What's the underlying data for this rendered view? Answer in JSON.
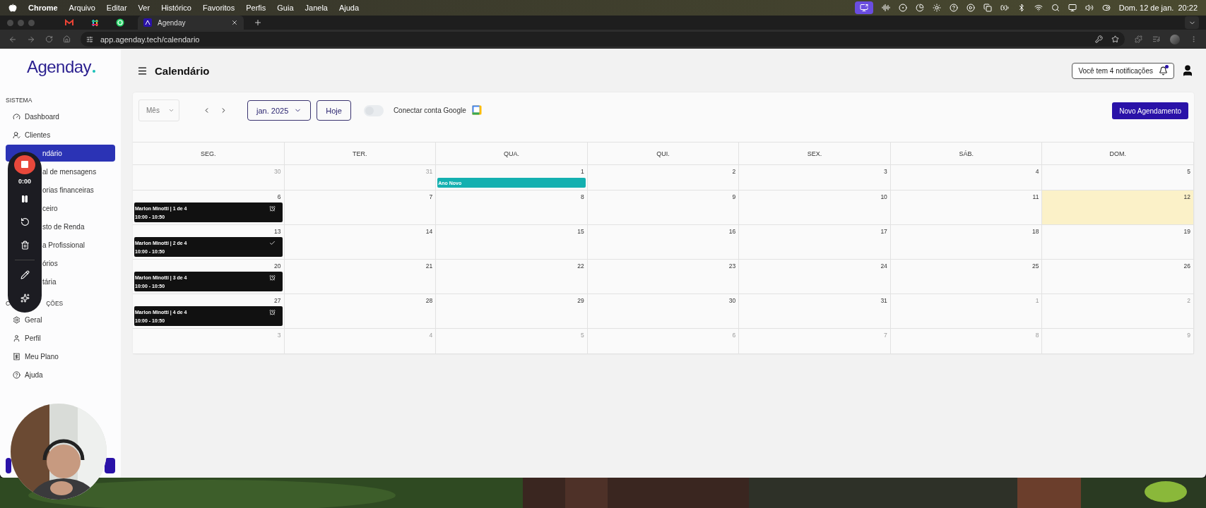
{
  "menu_bar": {
    "app": "Chrome",
    "menus": [
      "Arquivo",
      "Editar",
      "Ver",
      "Histórico",
      "Favoritos",
      "Perfis",
      "Guia",
      "Janela",
      "Ajuda"
    ],
    "clock": "Dom. 12 de jan.  20:22"
  },
  "browser": {
    "tabs": [
      {
        "kind": "mail",
        "selected": false
      },
      {
        "kind": "hash",
        "selected": false
      },
      {
        "kind": "chat",
        "selected": false
      },
      {
        "kind": "page",
        "title": "Agenday",
        "selected": true
      }
    ],
    "url": "app.agenday.tech/calendario"
  },
  "sidebar": {
    "logo": "Agenday",
    "sections": [
      {
        "title_parts": [
          "SISTEMA"
        ],
        "items": [
          {
            "label": "Dashboard",
            "kind": "full",
            "selected": false
          },
          {
            "label": "Clientes",
            "kind": "full",
            "selected": false
          },
          {
            "label": "ndário",
            "kind": "cut",
            "selected": true
          },
          {
            "label": "al de mensagens",
            "kind": "cut",
            "selected": false
          },
          {
            "label": "orias financeiras",
            "kind": "cut",
            "selected": false
          },
          {
            "label": "ceiro",
            "kind": "cut",
            "selected": false
          },
          {
            "label": "sto de Renda",
            "kind": "cut",
            "selected": false
          },
          {
            "label": "a Profissional",
            "kind": "cut",
            "selected": false
          },
          {
            "label": "órios",
            "kind": "cut",
            "selected": false
          },
          {
            "label": "tária",
            "kind": "cut",
            "selected": false
          }
        ]
      },
      {
        "title_parts": [
          "C",
          "ÇÕES"
        ],
        "items": [
          {
            "label": "Geral",
            "kind": "full",
            "selected": false
          },
          {
            "label": "Perfil",
            "kind": "full",
            "selected": false
          },
          {
            "label": "Meu Plano",
            "kind": "full",
            "selected": false
          },
          {
            "label": "Ajuda",
            "kind": "full",
            "selected": false
          }
        ]
      }
    ]
  },
  "recorder": {
    "time": "0:00"
  },
  "header": {
    "title": "Calendário",
    "notifications": "Você tem 4 notificações",
    "unread": true
  },
  "toolbar": {
    "view": "Mês",
    "month": "jan. 2025",
    "today": "Hoje",
    "google": {
      "label": "Conectar conta Google",
      "on": false
    },
    "new_button": "Novo Agendamento"
  },
  "calendar": {
    "weekdays": [
      "SEG.",
      "TER.",
      "QUA.",
      "QUI.",
      "SEX.",
      "SÁB.",
      "DOM."
    ],
    "weeks": [
      [
        {
          "day": "30",
          "muted": true,
          "today": false
        },
        {
          "day": "31",
          "muted": true,
          "today": false
        },
        {
          "day": "1",
          "muted": false,
          "today": false,
          "events": [
            {
              "kind": "holiday",
              "title": "Ano Novo",
              "color": "#14b0b0"
            }
          ]
        },
        {
          "day": "2",
          "muted": false,
          "today": false
        },
        {
          "day": "3",
          "muted": false,
          "today": false
        },
        {
          "day": "4",
          "muted": false,
          "today": false
        },
        {
          "day": "5",
          "muted": false,
          "today": false
        }
      ],
      [
        {
          "day": "6",
          "muted": false,
          "today": false,
          "events": [
            {
              "kind": "appointment",
              "title": "Marlon Minotti | 1 de 4",
              "time": "10:00 - 10:50",
              "done": false
            }
          ]
        },
        {
          "day": "7",
          "muted": false,
          "today": false
        },
        {
          "day": "8",
          "muted": false,
          "today": false
        },
        {
          "day": "9",
          "muted": false,
          "today": false
        },
        {
          "day": "10",
          "muted": false,
          "today": false
        },
        {
          "day": "11",
          "muted": false,
          "today": false
        },
        {
          "day": "12",
          "muted": false,
          "today": true
        }
      ],
      [
        {
          "day": "13",
          "muted": false,
          "today": false,
          "events": [
            {
              "kind": "appointment",
              "title": "Marlon Minotti | 2 de 4",
              "time": "10:00 - 10:50",
              "done": true
            }
          ]
        },
        {
          "day": "14",
          "muted": false,
          "today": false
        },
        {
          "day": "15",
          "muted": false,
          "today": false
        },
        {
          "day": "16",
          "muted": false,
          "today": false
        },
        {
          "day": "17",
          "muted": false,
          "today": false
        },
        {
          "day": "18",
          "muted": false,
          "today": false
        },
        {
          "day": "19",
          "muted": false,
          "today": false
        }
      ],
      [
        {
          "day": "20",
          "muted": false,
          "today": false,
          "events": [
            {
              "kind": "appointment",
              "title": "Marlon Minotti | 3 de 4",
              "time": "10:00 - 10:50",
              "done": false
            }
          ]
        },
        {
          "day": "21",
          "muted": false,
          "today": false
        },
        {
          "day": "22",
          "muted": false,
          "today": false
        },
        {
          "day": "23",
          "muted": false,
          "today": false
        },
        {
          "day": "24",
          "muted": false,
          "today": false
        },
        {
          "day": "25",
          "muted": false,
          "today": false
        },
        {
          "day": "26",
          "muted": false,
          "today": false
        }
      ],
      [
        {
          "day": "27",
          "muted": false,
          "today": false,
          "events": [
            {
              "kind": "appointment",
              "title": "Marlon Minotti | 4 de 4",
              "time": "10:00 - 10:50",
              "done": false
            }
          ]
        },
        {
          "day": "28",
          "muted": false,
          "today": false
        },
        {
          "day": "29",
          "muted": false,
          "today": false
        },
        {
          "day": "30",
          "muted": false,
          "today": false
        },
        {
          "day": "31",
          "muted": false,
          "today": false
        },
        {
          "day": "1",
          "muted": true,
          "today": false
        },
        {
          "day": "2",
          "muted": true,
          "today": false
        }
      ],
      [
        {
          "day": "3",
          "muted": true,
          "today": false
        },
        {
          "day": "4",
          "muted": true,
          "today": false
        },
        {
          "day": "5",
          "muted": true,
          "today": false
        },
        {
          "day": "6",
          "muted": true,
          "today": false
        },
        {
          "day": "7",
          "muted": true,
          "today": false
        },
        {
          "day": "8",
          "muted": true,
          "today": false
        },
        {
          "day": "9",
          "muted": true,
          "today": false
        }
      ]
    ]
  }
}
